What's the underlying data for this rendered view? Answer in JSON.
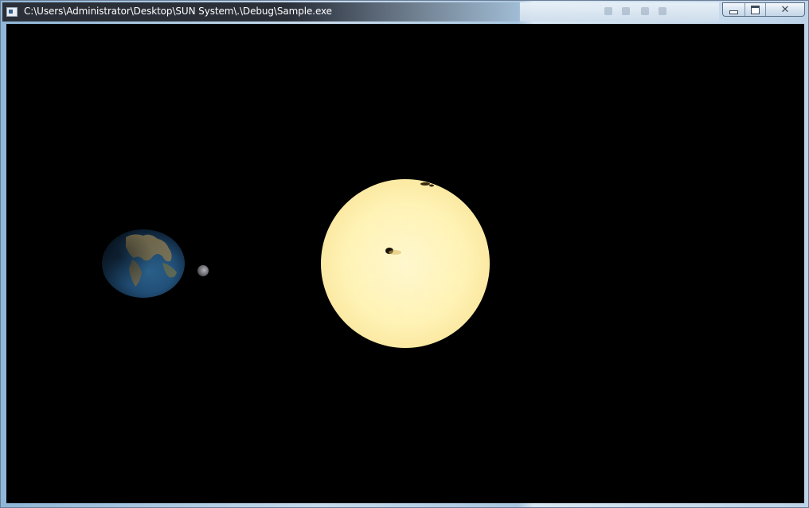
{
  "window": {
    "title": "C:\\Users\\Administrator\\Desktop\\SUN System\\.\\Debug\\Sample.exe",
    "icon": "console-app-icon",
    "buttons": {
      "minimize_icon": "minimize-icon",
      "maximize_icon": "maximize-icon",
      "close_icon": "close-icon",
      "close_glyph": "✕"
    }
  },
  "scene": {
    "background_color": "#000000",
    "bodies": [
      {
        "name": "sun",
        "color": "#fff3b0"
      },
      {
        "name": "earth",
        "color": "#2b5d86"
      },
      {
        "name": "moon",
        "color": "#8a8a90"
      }
    ]
  }
}
